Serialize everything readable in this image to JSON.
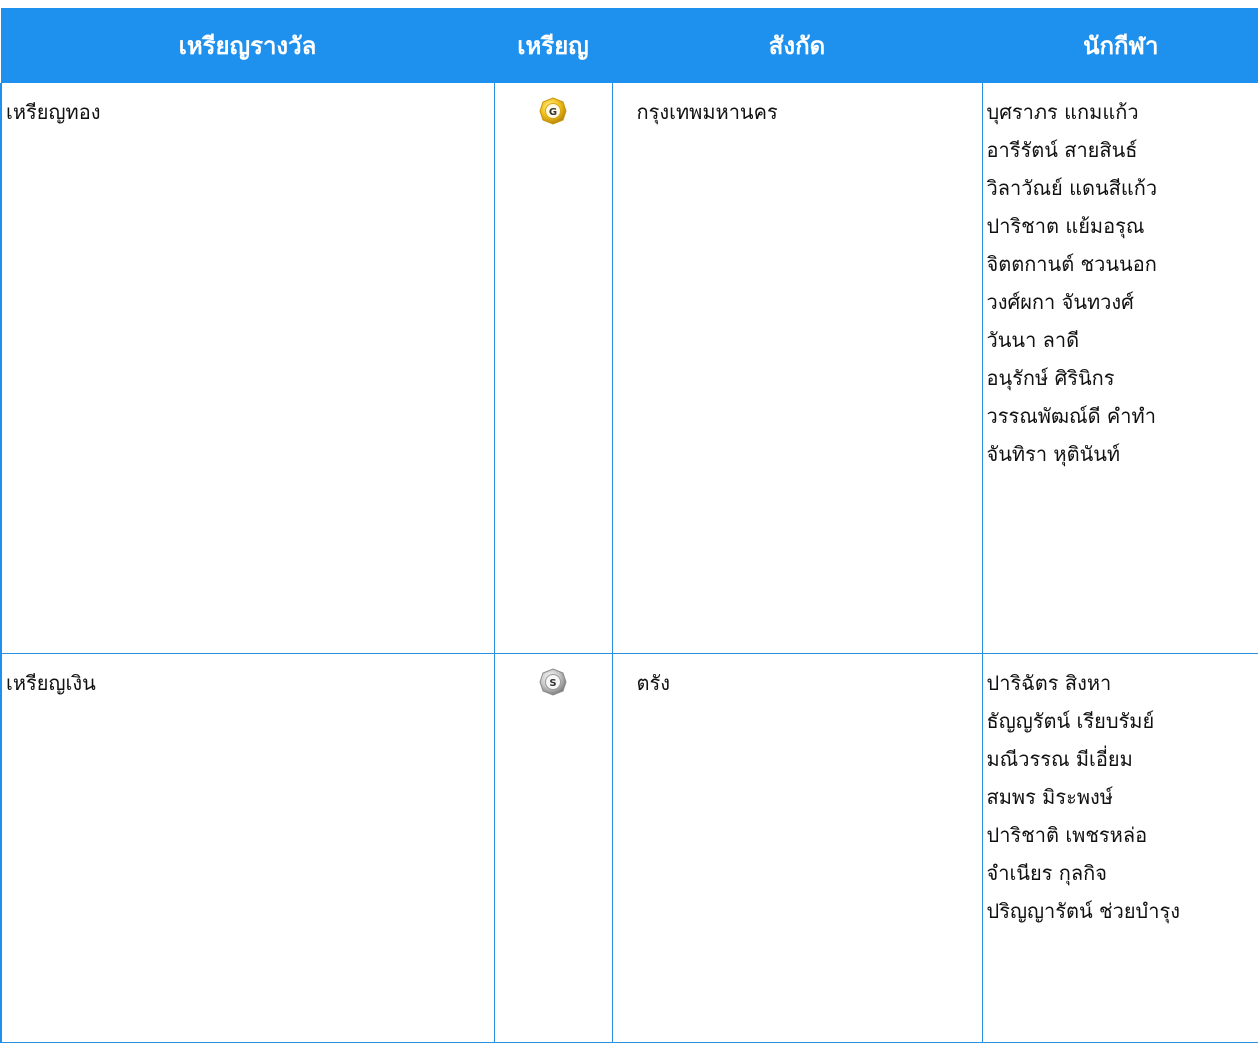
{
  "table": {
    "headers": {
      "award": "เหรียญรางวัล",
      "medal": "เหรียญ",
      "team": "สังกัด",
      "athletes": "นักกีฬา"
    },
    "rows": [
      {
        "award": "เหรียญทอง",
        "medal_icon": "gold-medal-icon",
        "medal_letter": "G",
        "team": "กรุงเทพมหานคร",
        "athletes": [
          "บุศราภร  แกมแก้ว",
          "อารีรัตน์  สายสินธ์",
          "วิลาวัณย์  แดนสีแก้ว",
          "ปาริชาต  แย้มอรุณ",
          "จิตตกานต์  ชวนนอก",
          "วงศ์ผกา  จันทวงศ์",
          "วันนา  ลาดี",
          "อนุรักษ์  ศิรินิกร",
          "วรรณพัฒณ์ดี  คำทำ",
          "จันทิรา  หุตินันท์"
        ]
      },
      {
        "award": "เหรียญเงิน",
        "medal_icon": "silver-medal-icon",
        "medal_letter": "S",
        "team": "ตรัง",
        "athletes": [
          "ปาริฉัตร  สิงหา",
          "ธัญญรัตน์  เรียบรัมย์",
          "มณีวรรณ  มีเอี่ยม",
          "สมพร  มิระพงษ์",
          "ปาริชาติ  เพชรหล่อ",
          "จำเนียร  กุลกิจ",
          "ปริญญารัตน์  ช่วยบำรุง"
        ]
      }
    ]
  },
  "colors": {
    "header_bg": "#1e90ee",
    "header_text": "#ffffff",
    "border": "#2b8fe0",
    "gold": "#f2c21b",
    "silver": "#c9c9c9"
  }
}
